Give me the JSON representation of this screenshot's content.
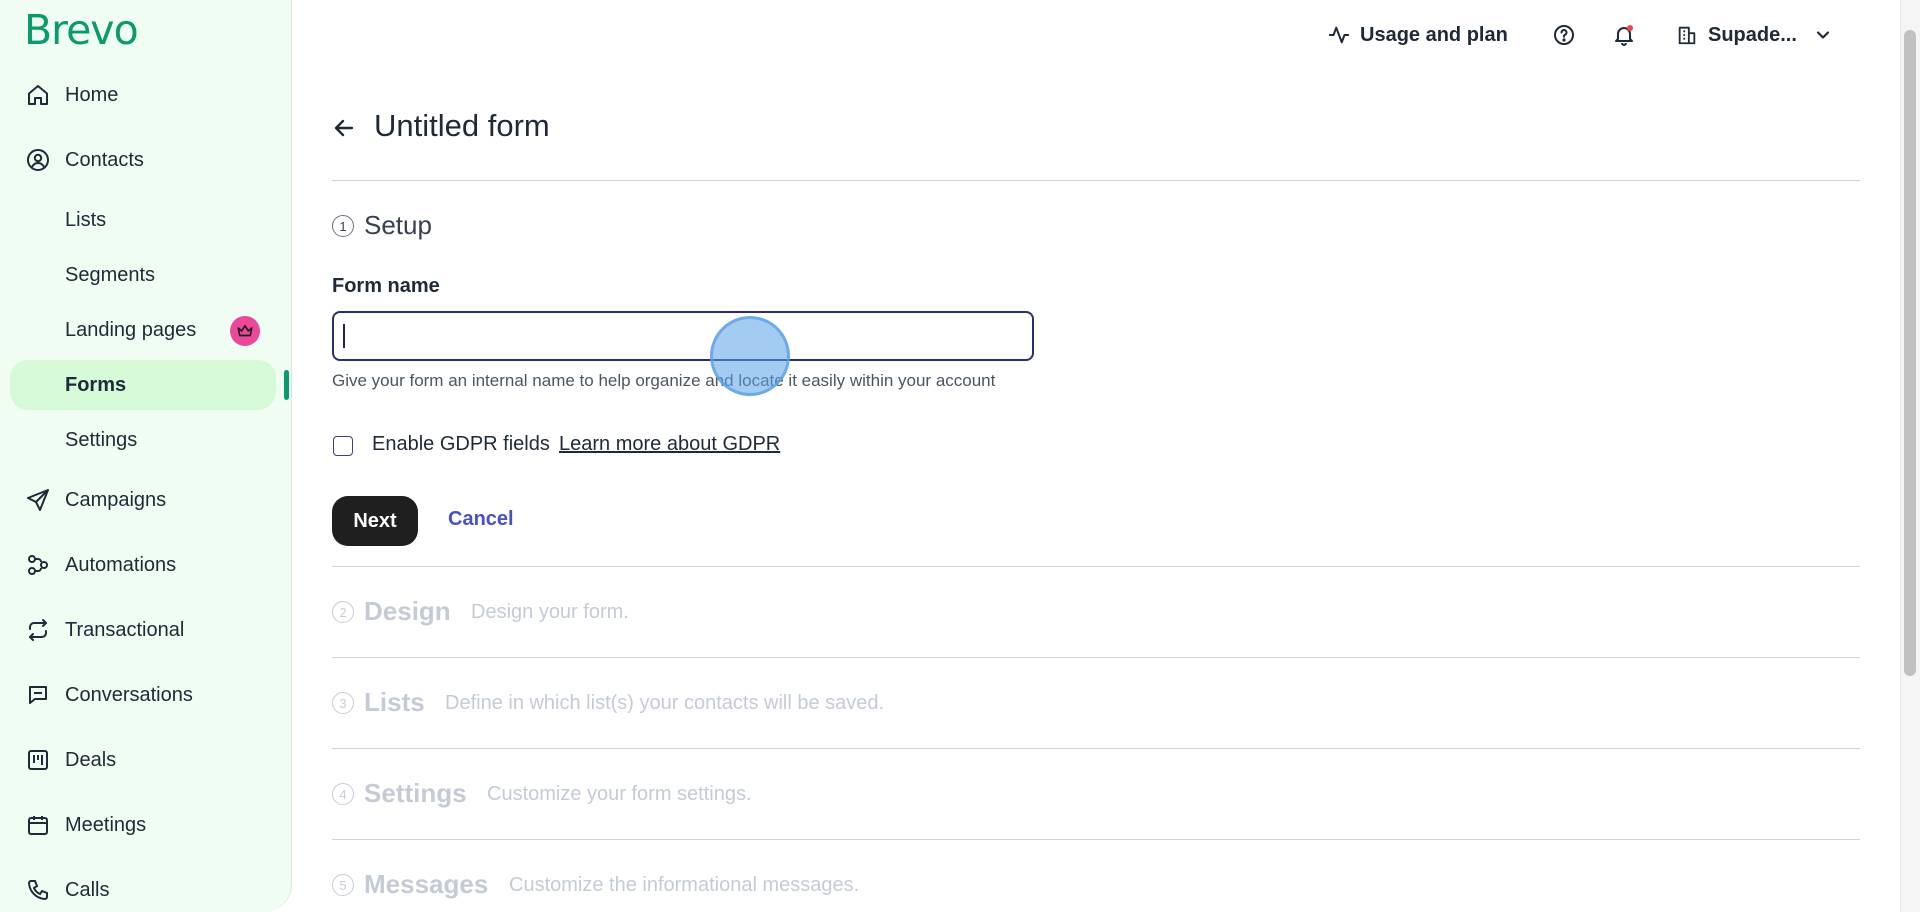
{
  "sidebar": {
    "logo": "Brevo",
    "nav": {
      "home": "Home",
      "contacts": "Contacts",
      "campaigns": "Campaigns",
      "automations": "Automations",
      "transactional": "Transactional",
      "conversations": "Conversations",
      "deals": "Deals",
      "meetings": "Meetings",
      "calls": "Calls"
    },
    "contacts_sub": {
      "lists": "Lists",
      "segments": "Segments",
      "landing_pages": "Landing pages",
      "forms": "Forms",
      "settings": "Settings"
    },
    "active_item": "Forms",
    "accent_color": "#0b996e"
  },
  "topbar": {
    "usage": "Usage and plan",
    "account": "Supade...",
    "help_icon": "question-circle-icon",
    "notification_icon": "bell-icon"
  },
  "main": {
    "title": "Untitled form",
    "steps": [
      {
        "num": "1",
        "title": "Setup",
        "desc": ""
      },
      {
        "num": "2",
        "title": "Design",
        "desc": "Design your form."
      },
      {
        "num": "3",
        "title": "Lists",
        "desc": "Define in which list(s) your contacts will be saved."
      },
      {
        "num": "4",
        "title": "Settings",
        "desc": "Customize your form settings."
      },
      {
        "num": "5",
        "title": "Messages",
        "desc": "Customize the informational messages."
      }
    ],
    "form": {
      "label": "Form name",
      "value": "",
      "help": "Give your form an internal name to help organize and locate it easily within your account",
      "gdpr_label": "Enable GDPR fields",
      "gdpr_link": "Learn more about GDPR",
      "gdpr_checked": false
    },
    "buttons": {
      "next": "Next",
      "cancel": "Cancel"
    }
  }
}
